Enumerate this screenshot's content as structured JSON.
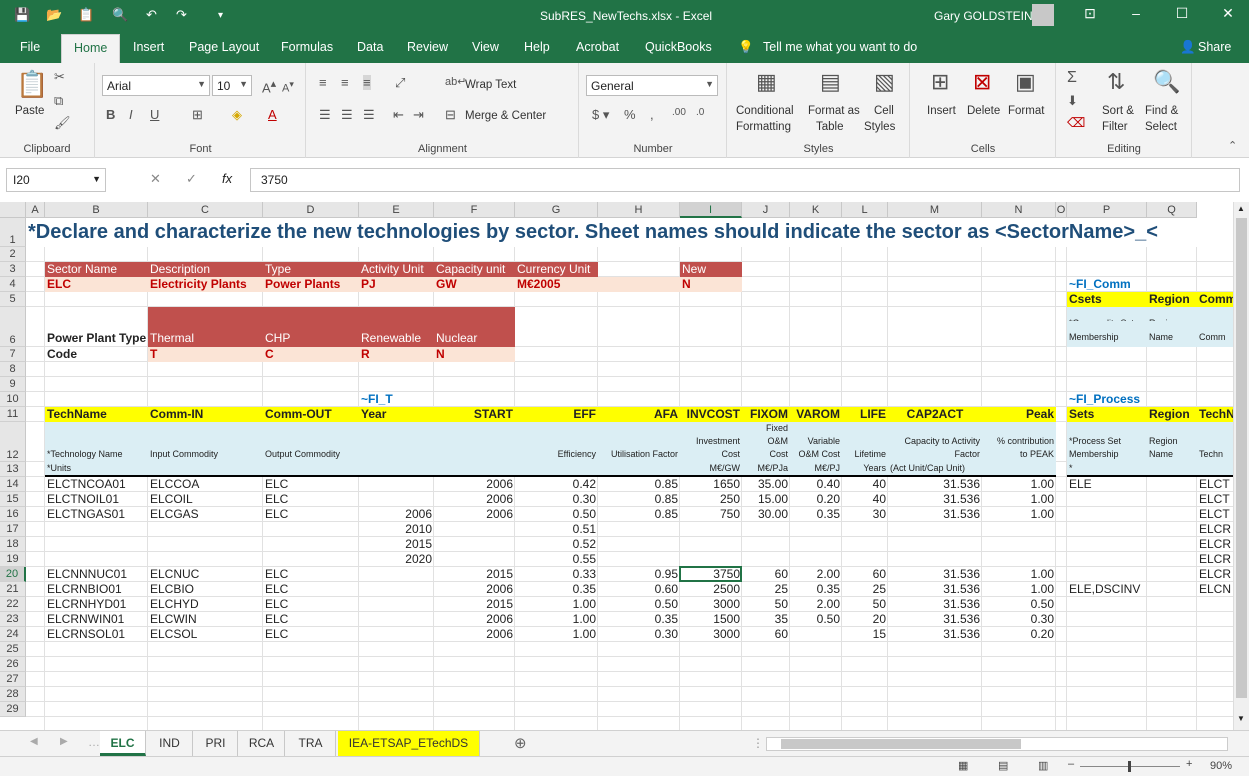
{
  "window": {
    "doc_title": "SubRES_NewTechs.xlsx  -  Excel",
    "user": "Gary GOLDSTEIN"
  },
  "menu": {
    "file": "File",
    "home": "Home",
    "insert": "Insert",
    "page_layout": "Page Layout",
    "formulas": "Formulas",
    "data": "Data",
    "review": "Review",
    "view": "View",
    "help": "Help",
    "acrobat": "Acrobat",
    "quickbooks": "QuickBooks",
    "tell_me": "Tell me what you want to do",
    "share": "Share"
  },
  "ribbon": {
    "paste": "Paste",
    "clipboard": "Clipboard",
    "font_name": "Arial",
    "font_size": "10",
    "font": "Font",
    "wrap_text": "Wrap Text",
    "merge_center": "Merge & Center",
    "alignment": "Alignment",
    "number_format": "General",
    "number": "Number",
    "conditional": "Conditional",
    "formatting": "Formatting",
    "format_as": "Format as",
    "table": "Table",
    "cell": "Cell",
    "styles_label": "Styles",
    "styles": "Styles",
    "insert": "Insert",
    "delete": "Delete",
    "format": "Format",
    "cells": "Cells",
    "sort_filter": "Sort &",
    "filter": "Filter",
    "find_select": "Find &",
    "select": "Select",
    "editing": "Editing"
  },
  "formula": {
    "name_box": "I20",
    "fx": "fx",
    "value": "3750"
  },
  "columns": [
    "A",
    "B",
    "C",
    "D",
    "E",
    "F",
    "G",
    "H",
    "I",
    "J",
    "K",
    "L",
    "M",
    "N",
    "O",
    "P",
    "Q"
  ],
  "rows": [
    "1",
    "2",
    "3",
    "4",
    "5",
    "6",
    "7",
    "8",
    "9",
    "10",
    "11",
    "12",
    "13",
    "14",
    "15",
    "16",
    "17",
    "18",
    "19",
    "20",
    "21",
    "22",
    "23",
    "24",
    "25",
    "26",
    "27",
    "28",
    "29"
  ],
  "sheet": {
    "title": "*Declare and characterize the new technologies by sector. Sheet names should indicate the sector as <SectorName>_<",
    "r3": {
      "b": "Sector Name",
      "c": "Description",
      "d": "Type",
      "e": "Activity Unit",
      "f": "Capacity unit",
      "g": "Currency Unit",
      "i": "New"
    },
    "r4": {
      "b": "ELC",
      "c": "Electricity Plants",
      "d": "Power Plants",
      "e": "PJ",
      "f": "GW",
      "g": "M€2005",
      "i": "N",
      "p": "~FI_Comm"
    },
    "r5": {
      "p": "Csets",
      "q": "Region",
      "r": "Comm"
    },
    "r6": {
      "b": "Power Plant Type",
      "c": "Thermal",
      "d": "CHP",
      "e": "Renewable",
      "f": "Nuclear",
      "p1": "*Commodity Set",
      "p2": "Membership",
      "q1": "Region",
      "q2": "Name",
      "r": "Comm"
    },
    "r7": {
      "b": "Code",
      "c": "T",
      "d": "C",
      "e": "R",
      "f": "N"
    },
    "r10": {
      "e": "~FI_T",
      "p": "~FI_Process"
    },
    "r11": {
      "b": "TechName",
      "c": "Comm-IN",
      "d": "Comm-OUT",
      "e": "Year",
      "f": "START",
      "g": "EFF",
      "h": "AFA",
      "i": "INVCOST",
      "j": "FIXOM",
      "k": "VAROM",
      "l": "LIFE",
      "m": "CAP2ACT",
      "n": "Peak",
      "p": "Sets",
      "q": "Region",
      "r": "TechN"
    },
    "r12": {
      "b": "*Technology Name",
      "c": "Input Commodity",
      "d": "Output Commodity",
      "g": "Efficiency",
      "h": "Utilisation Factor",
      "i1": "Investment",
      "i2": "Cost",
      "j1": "Fixed",
      "j2": "O&M",
      "j3": "Cost",
      "k1": "Variable",
      "k2": "O&M Cost",
      "l": "Lifetime",
      "m1": "Capacity to Activity",
      "m2": "Factor",
      "n1": "% contribution",
      "n2": "to PEAK",
      "p1": "*Process Set",
      "p2": "Membership",
      "q1": "Region",
      "q2": "Name",
      "r": "Techn"
    },
    "r13": {
      "b": "*Units",
      "i": "M€/GW",
      "j": "M€/PJa",
      "k": "M€/PJ",
      "l": "Years",
      "m": "(Act Unit/Cap Unit)",
      "p": "*"
    },
    "data": [
      {
        "row": 14,
        "b": "ELCTNCOA01",
        "c": "ELCCOA",
        "d": "ELC",
        "e": "",
        "f": "2006",
        "g": "0.42",
        "h": "0.85",
        "i": "1650",
        "j": "35.00",
        "k": "0.40",
        "l": "40",
        "m": "31.536",
        "n": "1.00",
        "p": "ELE",
        "r": "ELCT"
      },
      {
        "row": 15,
        "b": "ELCTNOIL01",
        "c": "ELCOIL",
        "d": "ELC",
        "e": "",
        "f": "2006",
        "g": "0.30",
        "h": "0.85",
        "i": "250",
        "j": "15.00",
        "k": "0.20",
        "l": "40",
        "m": "31.536",
        "n": "1.00",
        "p": "",
        "r": "ELCT"
      },
      {
        "row": 16,
        "b": "ELCTNGAS01",
        "c": "ELCGAS",
        "d": "ELC",
        "e": "2006",
        "f": "2006",
        "g": "0.50",
        "h": "0.85",
        "i": "750",
        "j": "30.00",
        "k": "0.35",
        "l": "30",
        "m": "31.536",
        "n": "1.00",
        "p": "",
        "r": "ELCT"
      },
      {
        "row": 17,
        "b": "",
        "c": "",
        "d": "",
        "e": "2010",
        "f": "",
        "g": "0.51",
        "h": "",
        "i": "",
        "j": "",
        "k": "",
        "l": "",
        "m": "",
        "n": "",
        "p": "",
        "r": "ELCR"
      },
      {
        "row": 18,
        "b": "",
        "c": "",
        "d": "",
        "e": "2015",
        "f": "",
        "g": "0.52",
        "h": "",
        "i": "",
        "j": "",
        "k": "",
        "l": "",
        "m": "",
        "n": "",
        "p": "",
        "r": "ELCR"
      },
      {
        "row": 19,
        "b": "",
        "c": "",
        "d": "",
        "e": "2020",
        "f": "",
        "g": "0.55",
        "h": "",
        "i": "",
        "j": "",
        "k": "",
        "l": "",
        "m": "",
        "n": "",
        "p": "",
        "r": "ELCR"
      },
      {
        "row": 20,
        "b": "ELCNNNUC01",
        "c": "ELCNUC",
        "d": "ELC",
        "e": "",
        "f": "2015",
        "g": "0.33",
        "h": "0.95",
        "i": "3750",
        "j": "60",
        "k": "2.00",
        "l": "60",
        "m": "31.536",
        "n": "1.00",
        "p": "",
        "r": "ELCR"
      },
      {
        "row": 21,
        "b": "ELCRNBIO01",
        "c": "ELCBIO",
        "d": "ELC",
        "e": "",
        "f": "2006",
        "g": "0.35",
        "h": "0.60",
        "i": "2500",
        "j": "25",
        "k": "0.35",
        "l": "25",
        "m": "31.536",
        "n": "1.00",
        "p": "ELE,DSCINV",
        "r": "ELCN"
      },
      {
        "row": 22,
        "b": "ELCRNHYD01",
        "c": "ELCHYD",
        "d": "ELC",
        "e": "",
        "f": "2015",
        "g": "1.00",
        "h": "0.50",
        "i": "3000",
        "j": "50",
        "k": "2.00",
        "l": "50",
        "m": "31.536",
        "n": "0.50",
        "p": "",
        "r": ""
      },
      {
        "row": 23,
        "b": "ELCRNWIN01",
        "c": "ELCWIN",
        "d": "ELC",
        "e": "",
        "f": "2006",
        "g": "1.00",
        "h": "0.35",
        "i": "1500",
        "j": "35",
        "k": "0.50",
        "l": "20",
        "m": "31.536",
        "n": "0.30",
        "p": "",
        "r": ""
      },
      {
        "row": 24,
        "b": "ELCRNSOL01",
        "c": "ELCSOL",
        "d": "ELC",
        "e": "",
        "f": "2006",
        "g": "1.00",
        "h": "0.30",
        "i": "3000",
        "j": "60",
        "k": "",
        "l": "15",
        "m": "31.536",
        "n": "0.20",
        "p": "",
        "r": ""
      }
    ]
  },
  "tabs": [
    "ELC",
    "IND",
    "PRI",
    "RCA",
    "TRA",
    "IEA-ETSAP_ETechDS"
  ],
  "zoom": "90%",
  "colors": {
    "excel_green": "#217346",
    "header_red": "#c0504d",
    "pink": "#fbe4d6",
    "yellow": "#ffff00",
    "light_blue": "#dbeef4",
    "title_blue": "#1f4e79"
  }
}
